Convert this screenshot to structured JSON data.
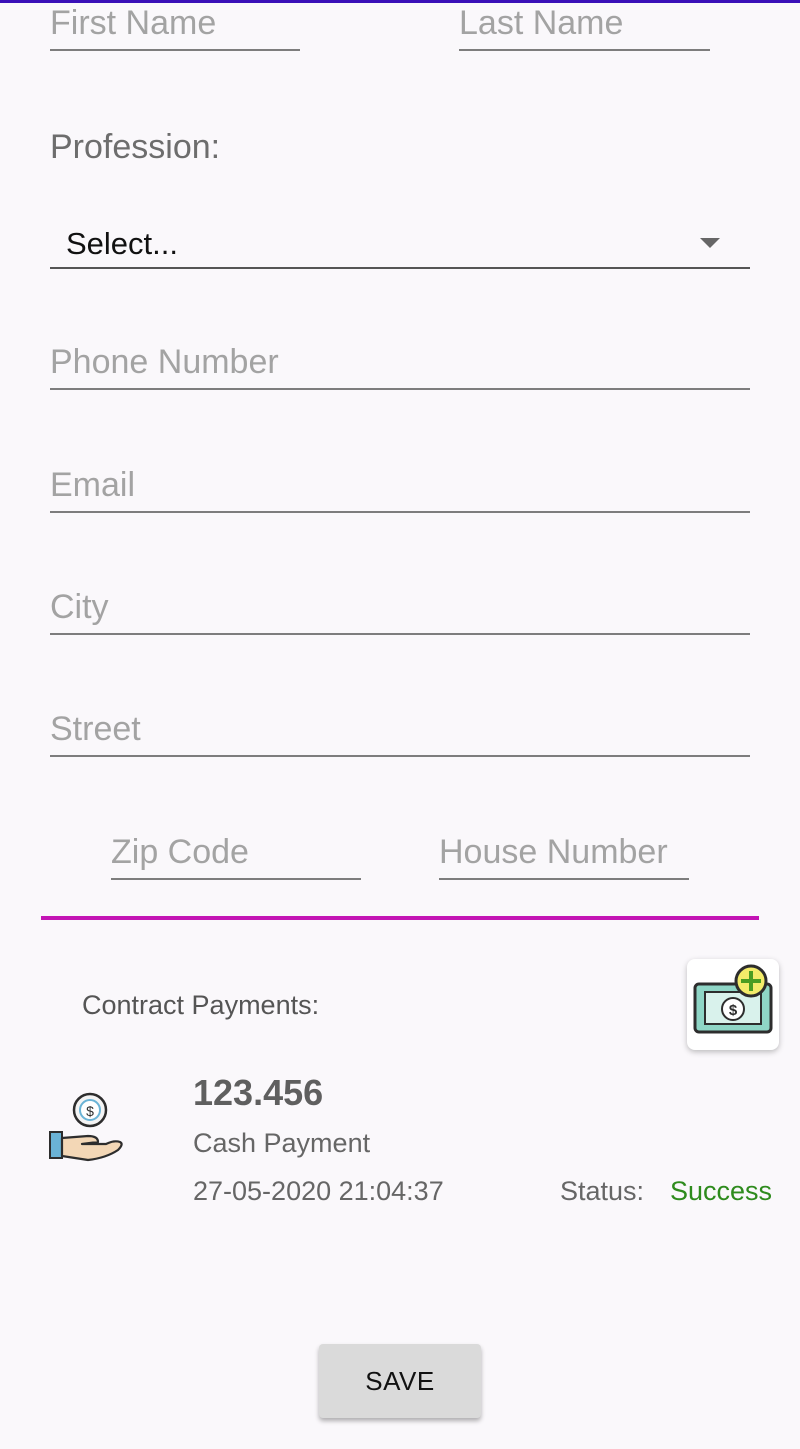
{
  "form": {
    "first_name": {
      "placeholder": "First Name",
      "value": ""
    },
    "last_name": {
      "placeholder": "Last Name",
      "value": ""
    },
    "profession_label": "Profession:",
    "profession_select": "Select...",
    "phone": {
      "placeholder": "Phone Number",
      "value": ""
    },
    "email": {
      "placeholder": "Email",
      "value": ""
    },
    "city": {
      "placeholder": "City",
      "value": ""
    },
    "street": {
      "placeholder": "Street",
      "value": ""
    },
    "zip": {
      "placeholder": "Zip Code",
      "value": ""
    },
    "house_number": {
      "placeholder": "House Number",
      "value": ""
    }
  },
  "payments": {
    "title": "Contract Payments:",
    "add_icon": "add-money-icon",
    "items": [
      {
        "icon": "cash-hand-icon",
        "amount": "123.456",
        "type": "Cash Payment",
        "date": "27-05-2020 21:04:37",
        "status_label": "Status:",
        "status": "Success"
      }
    ]
  },
  "save_label": "SAVE",
  "colors": {
    "accent": "#c314b4",
    "status_success": "#2e8b1d",
    "top_bar": "#3a10b8"
  }
}
